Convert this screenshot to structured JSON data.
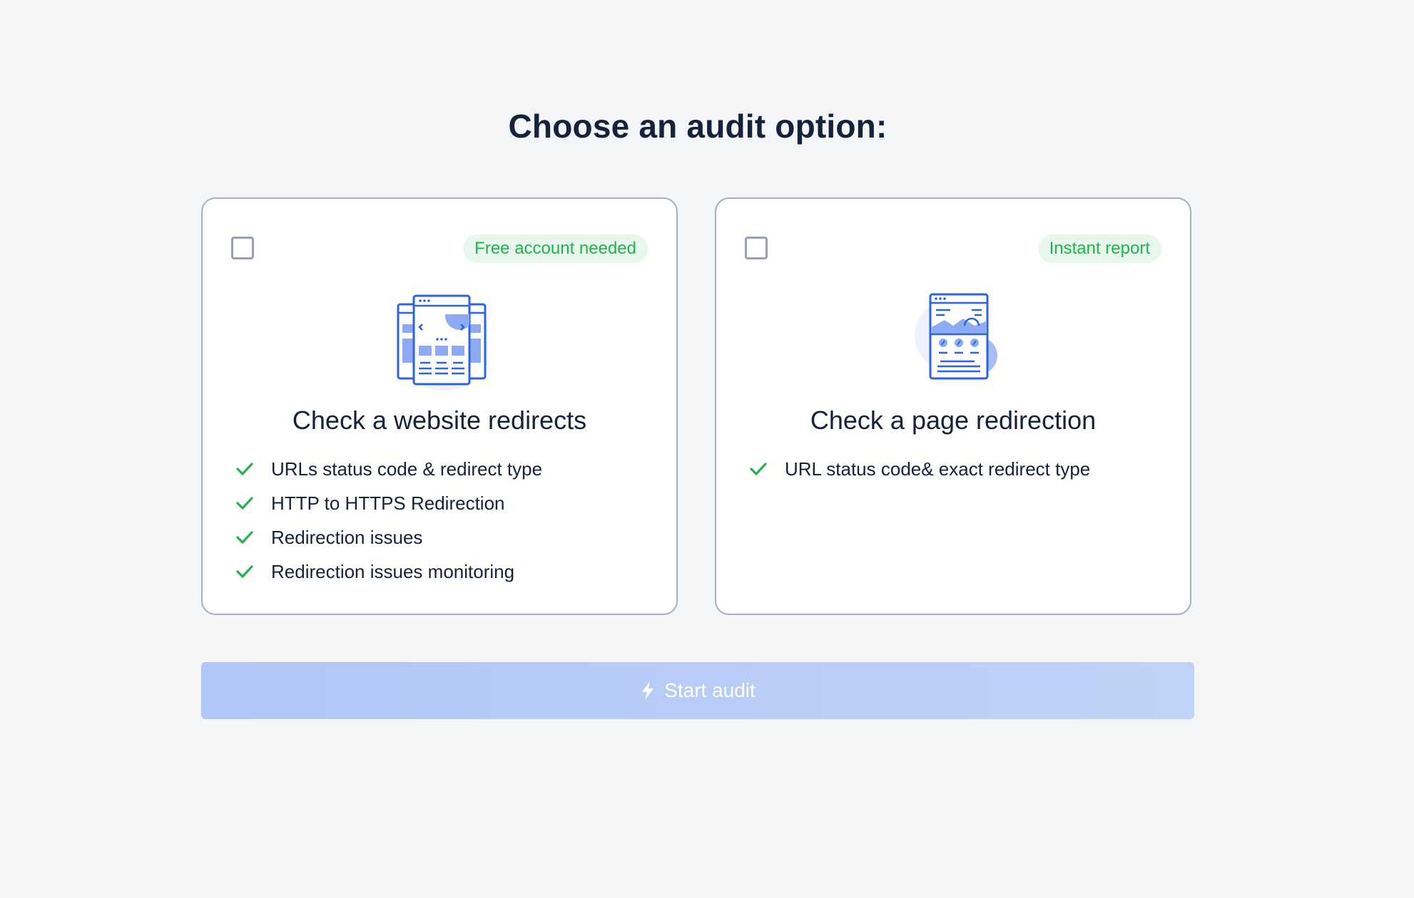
{
  "page": {
    "title": "Choose an audit option:"
  },
  "colors": {
    "background": "#f4f5f7",
    "text_primary": "#15223b",
    "card_border": "#a7aebd",
    "badge_bg": "#e7f7ec",
    "badge_text": "#23b24f",
    "check_green": "#23b24f",
    "accent_blue": "#2b63e6",
    "button_disabled": "#b5cbf7"
  },
  "options": [
    {
      "badge": "Free account needed",
      "title": "Check a website redirects",
      "icon": "website-pages-icon",
      "selected": false,
      "features": [
        "URLs status code & redirect type",
        "HTTP to HTTPS Redirection",
        "Redirection issues",
        "Redirection issues monitoring"
      ]
    },
    {
      "badge": "Instant report",
      "title": "Check a page redirection",
      "icon": "single-page-icon",
      "selected": false,
      "features": [
        "URL status code& exact redirect type"
      ]
    }
  ],
  "start_button": {
    "label": "Start audit",
    "icon": "lightning-icon",
    "enabled": false
  }
}
